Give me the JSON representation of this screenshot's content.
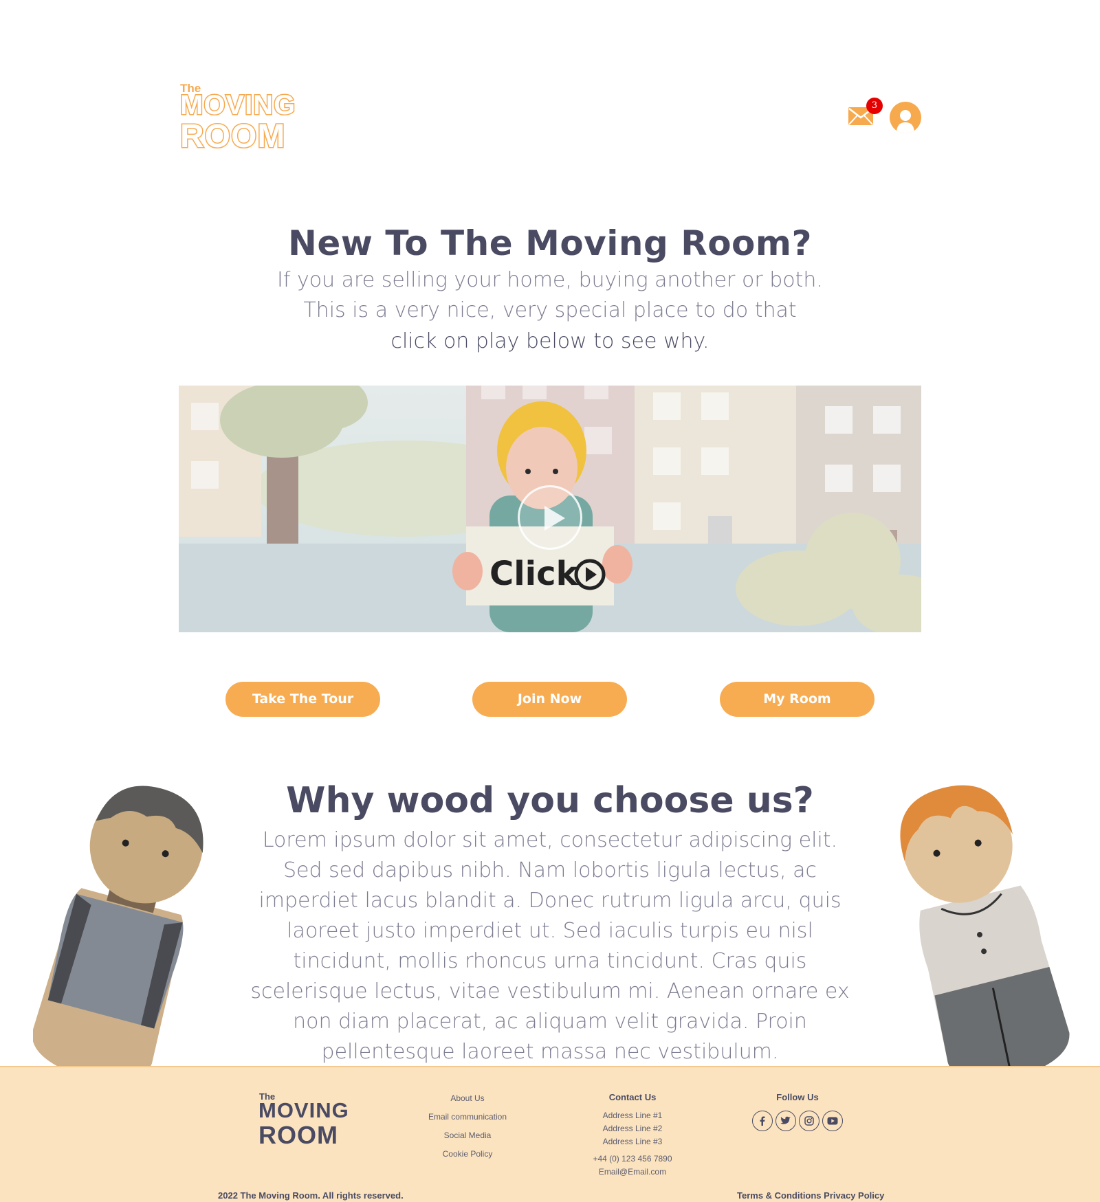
{
  "brand": {
    "logo_the": "The",
    "logo_moving": "MOVING",
    "logo_room": "ROOM",
    "accent": "#f7ac52",
    "text_dark": "#4a4b63",
    "footer_bg": "#fbe3bf"
  },
  "header": {
    "mail_icon": "envelope-icon",
    "notification_count": "3",
    "avatar_icon": "user-avatar-icon"
  },
  "hero": {
    "title": "New To The Moving Room?",
    "line1": "If you are selling your home, buying another or both.",
    "line2": "This is a very nice, very special place to do that",
    "line3": "click on play below to see why.",
    "video_sign_text": "Click"
  },
  "actions": {
    "tour": "Take The Tour",
    "join": "Join Now",
    "room": "My Room"
  },
  "why": {
    "title": "Why wood you choose us?",
    "body": "Lorem ipsum dolor sit amet, consectetur adipiscing elit. Sed sed dapibus nibh. Nam lobortis ligula lectus, ac imperdiet lacus blandit a. Donec rutrum ligula arcu, quis laoreet justo imperdiet ut. Sed iaculis turpis eu nisl tincidunt, mollis rhoncus urna tincidunt. Cras quis scelerisque lectus, vitae vestibulum mi. Aenean ornare ex non diam placerat, ac aliquam velit gravida. Proin pellentesque laoreet massa nec vestibulum."
  },
  "footer": {
    "links": [
      "About Us",
      "Email communication",
      "Social Media",
      "Cookie Policy"
    ],
    "contact_heading": "Contact Us",
    "address": [
      "Address Line #1",
      "Address Line #2",
      "Address Line #3"
    ],
    "phone": "+44 (0) 123 456 7890",
    "email": "Email@Email.com",
    "follow_heading": "Follow Us",
    "social_icons": [
      "facebook-icon",
      "twitter-icon",
      "instagram-icon",
      "youtube-icon"
    ],
    "copyright": "2022 The Moving Room. All rights reserved.",
    "terms": "Terms & Conditions",
    "privacy": "Privacy Policy"
  }
}
